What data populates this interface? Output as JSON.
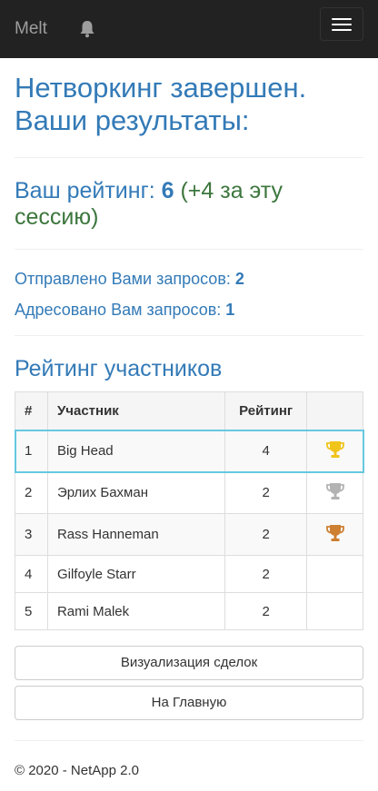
{
  "navbar": {
    "brand": "Melt",
    "bell_icon": "bell-icon",
    "menu_icon": "hamburger-menu-icon"
  },
  "title": "Нетворкинг завершен. Ваши результаты:",
  "rating": {
    "label": "Ваш рейтинг:",
    "value": "6",
    "delta": "(+4 за эту сессию)"
  },
  "stats": {
    "sent_label": "Отправлено Вами запросов:",
    "sent_value": "2",
    "received_label": "Адресовано Вам запросов:",
    "received_value": "1"
  },
  "leaderboard": {
    "title": "Рейтинг участников",
    "headers": {
      "num": "#",
      "name": "Участник",
      "score": "Рейтинг"
    },
    "rows": [
      {
        "num": "1",
        "name": "Big Head",
        "score": "4",
        "trophy": "gold"
      },
      {
        "num": "2",
        "name": "Эрлих Бахман",
        "score": "2",
        "trophy": "silver"
      },
      {
        "num": "3",
        "name": "Rass Hanneman",
        "score": "2",
        "trophy": "bronze"
      },
      {
        "num": "4",
        "name": "Gilfoyle Starr",
        "score": "2"
      },
      {
        "num": "5",
        "name": "Rami Malek",
        "score": "2"
      }
    ]
  },
  "buttons": {
    "visualize": "Визуализация сделок",
    "home": "На Главную"
  },
  "footer": "© 2020 - NetApp 2.0",
  "colors": {
    "gold": "#f0c419",
    "silver": "#b3b3b3",
    "bronze": "#cd7f32",
    "link": "#337ab7",
    "success": "#3c763d",
    "highlight": "#66c8e0"
  }
}
